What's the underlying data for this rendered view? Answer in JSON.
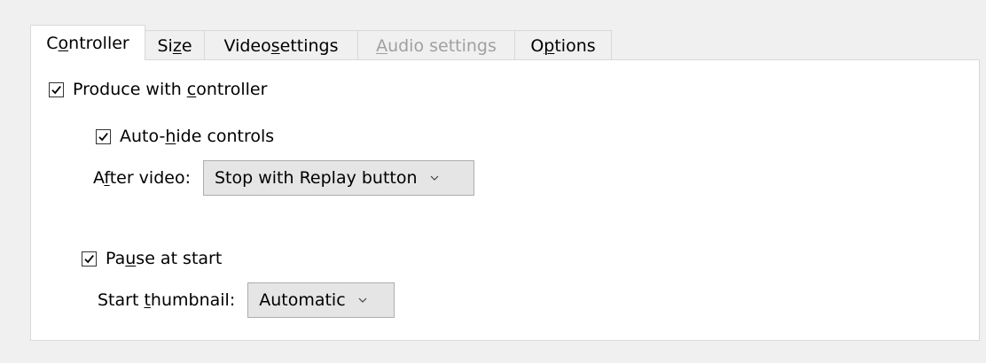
{
  "tabs": [
    {
      "pre": "C",
      "ul": "o",
      "post": "ntroller",
      "state": "active"
    },
    {
      "pre": "Si",
      "ul": "z",
      "post": "e",
      "state": "normal"
    },
    {
      "pre": "Video ",
      "ul": "s",
      "post": "ettings",
      "state": "normal"
    },
    {
      "pre": "",
      "ul": "A",
      "post": "udio settings",
      "state": "disabled"
    },
    {
      "pre": "O",
      "ul": "p",
      "post": "tions",
      "state": "normal"
    }
  ],
  "controller": {
    "produce": {
      "pre": "Produce with ",
      "ul": "c",
      "post": "ontroller",
      "checked": true
    },
    "autohide": {
      "pre": "Auto-",
      "ul": "h",
      "post": "ide controls",
      "checked": true
    },
    "after_video": {
      "pre": "A",
      "ul": "f",
      "post": "ter video:",
      "value": "Stop with Replay button"
    },
    "pause": {
      "pre": "Pa",
      "ul": "u",
      "post": "se at start",
      "checked": true
    },
    "start_thumb": {
      "pre": "Start ",
      "ul": "t",
      "post": "humbnail:",
      "value": "Automatic"
    }
  },
  "icons": {
    "check": "checkmark-icon",
    "dropdown": "chevron-down-icon"
  }
}
